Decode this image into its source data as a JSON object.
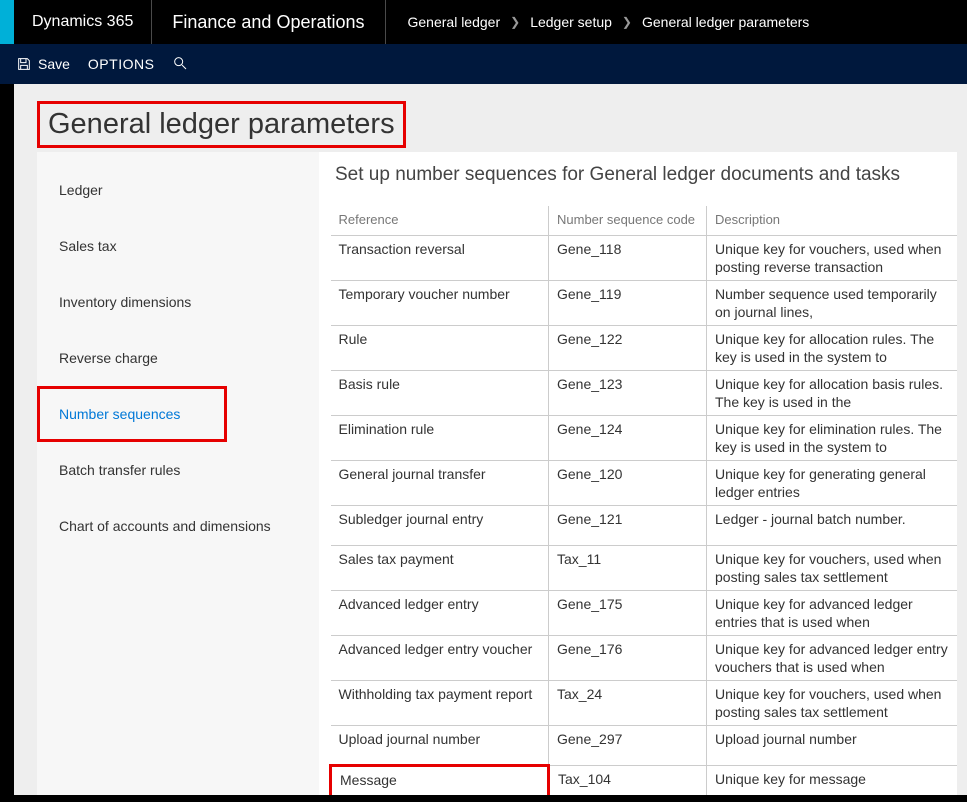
{
  "header": {
    "brand": "Dynamics 365",
    "app": "Finance and Operations",
    "breadcrumb": [
      "General ledger",
      "Ledger setup",
      "General ledger parameters"
    ]
  },
  "toolbar": {
    "save_label": "Save",
    "options_label": "OPTIONS"
  },
  "page": {
    "title": "General ledger parameters"
  },
  "sidebar": {
    "items": [
      {
        "label": "Ledger",
        "active": false
      },
      {
        "label": "Sales tax",
        "active": false
      },
      {
        "label": "Inventory dimensions",
        "active": false
      },
      {
        "label": "Reverse charge",
        "active": false
      },
      {
        "label": "Number sequences",
        "active": true
      },
      {
        "label": "Batch transfer rules",
        "active": false
      },
      {
        "label": "Chart of accounts and dimensions",
        "active": false
      }
    ]
  },
  "detail": {
    "title": "Set up number sequences for General ledger documents and tasks",
    "columns": [
      "Reference",
      "Number sequence code",
      "Description"
    ],
    "rows": [
      {
        "ref": "Transaction reversal",
        "code": "Gene_118",
        "desc": "Unique key for vouchers, used when posting reverse transaction"
      },
      {
        "ref": "Temporary voucher number",
        "code": "Gene_119",
        "desc": "Number sequence used temporarily on journal lines,"
      },
      {
        "ref": "Rule",
        "code": "Gene_122",
        "desc": "Unique key for allocation rules. The key is used in the system to"
      },
      {
        "ref": "Basis rule",
        "code": "Gene_123",
        "desc": "Unique key for allocation basis rules. The key is used in the"
      },
      {
        "ref": "Elimination rule",
        "code": "Gene_124",
        "desc": "Unique key for elimination rules. The key is used in the system to"
      },
      {
        "ref": "General journal transfer",
        "code": "Gene_120",
        "desc": "Unique key for generating general ledger entries"
      },
      {
        "ref": "Subledger journal entry",
        "code": "Gene_121",
        "desc": "Ledger - journal batch number."
      },
      {
        "ref": "Sales tax payment",
        "code": "Tax_11",
        "desc": "Unique key for vouchers, used when posting sales tax settlement"
      },
      {
        "ref": "Advanced ledger entry",
        "code": "Gene_175",
        "desc": "Unique key for advanced ledger entries that is used when"
      },
      {
        "ref": "Advanced ledger entry voucher",
        "code": "Gene_176",
        "desc": "Unique key for advanced ledger entry vouchers that is used when"
      },
      {
        "ref": "Withholding tax payment report",
        "code": "Tax_24",
        "desc": "Unique key for vouchers, used when posting sales tax settlement"
      },
      {
        "ref": "Upload journal number",
        "code": "Gene_297",
        "desc": "Upload journal number"
      },
      {
        "ref": "Message",
        "code": "Tax_104",
        "desc": "Unique key for message"
      }
    ]
  }
}
